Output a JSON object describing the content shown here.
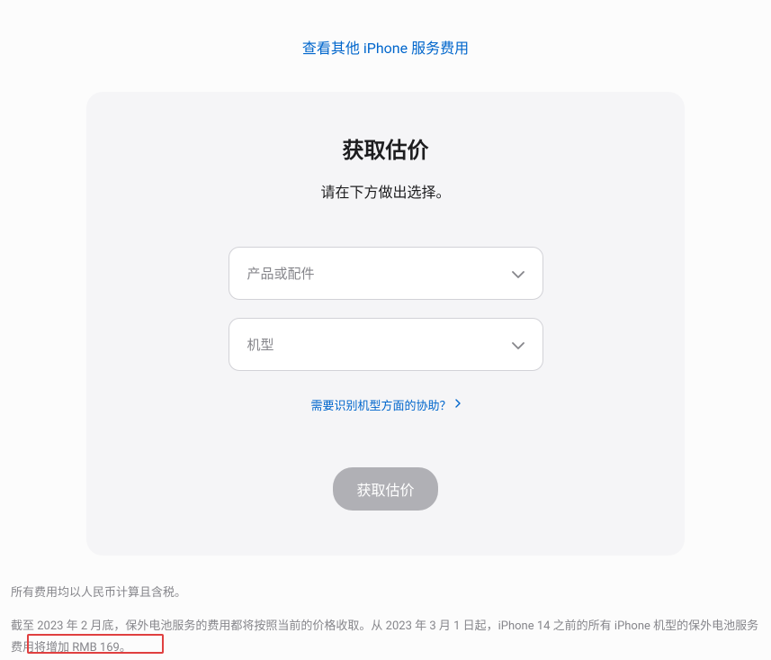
{
  "topLink": "查看其他 iPhone 服务费用",
  "card": {
    "title": "获取估价",
    "subtitle": "请在下方做出选择。",
    "select1": {
      "placeholder": "产品或配件"
    },
    "select2": {
      "placeholder": "机型"
    },
    "helpLink": "需要识别机型方面的协助？",
    "submitBtn": "获取估价"
  },
  "footer1": "所有费用均以人民币计算且含税。",
  "footer2": "截至 2023 年 2 月底，保外电池服务的费用都将按照当前的价格收取。从 2023 年 3 月 1 日起，iPhone 14 之前的所有 iPhone 机型的保外电池服务费用将增加 RMB 169。"
}
